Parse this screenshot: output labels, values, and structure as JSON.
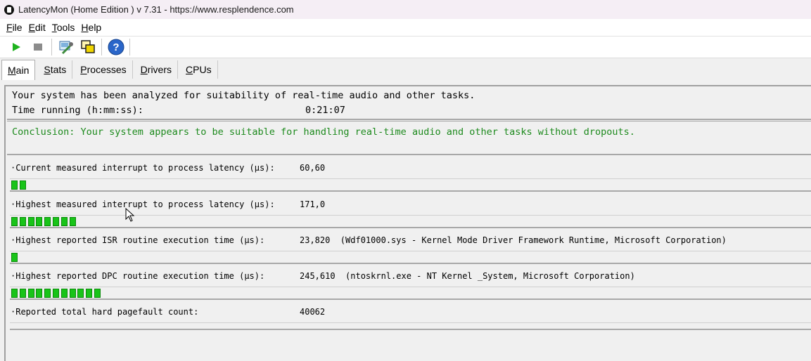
{
  "window": {
    "title": "LatencyMon  (Home Edition )  v 7.31 - https://www.resplendence.com"
  },
  "menu": [
    {
      "underline": "F",
      "rest": "ile"
    },
    {
      "underline": "E",
      "rest": "dit"
    },
    {
      "underline": "T",
      "rest": "ools"
    },
    {
      "underline": "H",
      "rest": "elp"
    }
  ],
  "toolbar": {
    "icons": [
      "play-icon",
      "stop-icon",
      "wrench-icon",
      "windows-icon",
      "help-icon"
    ]
  },
  "tabs": [
    {
      "underline": "M",
      "rest": "ain",
      "active": true
    },
    {
      "underline": "S",
      "rest": "tats",
      "active": false
    },
    {
      "underline": "P",
      "rest": "rocesses",
      "active": false
    },
    {
      "underline": "D",
      "rest": "rivers",
      "active": false
    },
    {
      "underline": "C",
      "rest": "PUs",
      "active": false
    }
  ],
  "main": {
    "analyzed_text": "Your system has been analyzed for suitability of real-time audio and other tasks.",
    "time_running_label": "Time running (h:mm:ss):",
    "time_running_value": "0:21:07",
    "conclusion": "Conclusion: Your system appears to be suitable for handling real-time audio and other tasks without dropouts.",
    "accent_color": "#1d8a1d",
    "metrics": [
      {
        "label": "·Current measured interrupt to process latency (µs):",
        "value": "60,60",
        "bar_segments": 2
      },
      {
        "label": "·Highest measured interrupt to process latency (µs):",
        "value": "171,0",
        "bar_segments": 8
      },
      {
        "label": "·Highest reported ISR routine execution time (µs):",
        "value": "23,820  (Wdf01000.sys - Kernel Mode Driver Framework Runtime, Microsoft Corporation)",
        "bar_segments": 1
      },
      {
        "label": "·Highest reported DPC routine execution time (µs):",
        "value": "245,610  (ntoskrnl.exe - NT Kernel _System, Microsoft Corporation)",
        "bar_segments": 11
      },
      {
        "label": "·Reported total hard pagefault count:",
        "value": "40062",
        "bar_segments": 0
      }
    ]
  }
}
